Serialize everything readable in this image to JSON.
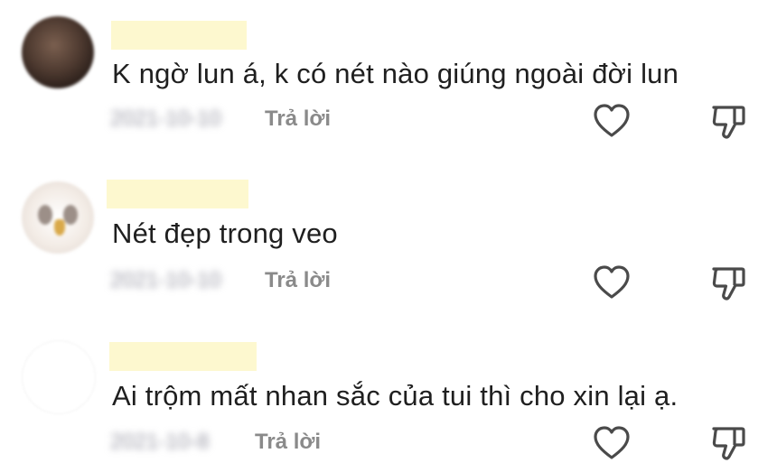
{
  "comments": [
    {
      "avatar": "dark-avatar",
      "text": "K ngờ lun á, k có nét nào giúng ngoài đời lun",
      "date": "2021-10-10",
      "reply_label": "Trả lời",
      "like_icon": "heart-outline-icon",
      "dislike_icon": "thumbs-down-outline-icon"
    },
    {
      "avatar": "owl-avatar",
      "text": "Nét đẹp trong veo",
      "date": "2021-10-10",
      "reply_label": "Trả lời",
      "like_icon": "heart-outline-icon",
      "dislike_icon": "thumbs-down-outline-icon"
    },
    {
      "avatar": "blank-avatar",
      "text": "Ai trộm mất nhan sắc của tui thì cho xin lại ạ.",
      "date": "2021-10-8",
      "reply_label": "Trả lời",
      "like_icon": "heart-outline-icon",
      "dislike_icon": "thumbs-down-outline-icon"
    }
  ],
  "colors": {
    "text": "#1f1f1f",
    "secondary": "#8a8a8a",
    "icon_stroke": "#4a4a4a",
    "username_highlight": "#fdf8cf"
  }
}
